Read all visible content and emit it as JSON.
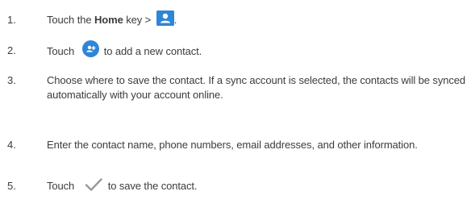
{
  "steps": [
    {
      "number": "1.",
      "parts": {
        "before": "Touch the ",
        "bold": "Home",
        "after": " key > ",
        "end": "."
      },
      "icon": "contacts-app-icon"
    },
    {
      "number": "2.",
      "parts": {
        "before": "Touch ",
        "after": "to add a new contact."
      },
      "icon": "add-contact-icon"
    },
    {
      "number": "3.",
      "text": "Choose where to save the contact. If a sync account is selected, the contacts will be synced automatically with your account online."
    },
    {
      "number": "4.",
      "text": "Enter the contact name, phone numbers, email addresses, and other information."
    },
    {
      "number": "5.",
      "parts": {
        "before": "Touch ",
        "after": "to save the contact."
      },
      "icon": "checkmark-icon"
    }
  ],
  "colors": {
    "text": "#3c3c3c",
    "icon_blue": "#2f86d6",
    "check_gray": "#9a9a9a"
  }
}
